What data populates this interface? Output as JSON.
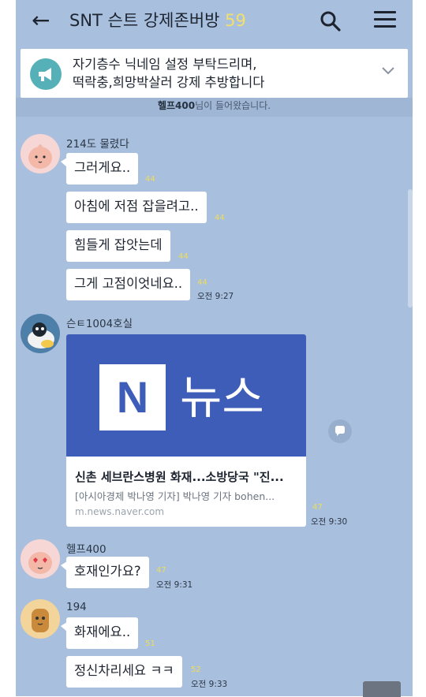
{
  "header": {
    "back": "←",
    "title": "SNT 슨트 강제존버방",
    "member_count": "59"
  },
  "notice": {
    "line1": "자기층수 닉네임 설정 부탁드리며,",
    "line2": "떡락충,희망박살러 강제 추방합니다"
  },
  "system_message": {
    "name": "헬프400",
    "suffix": "님이 들어왔습니다."
  },
  "messages": [
    {
      "sender": "214도 물렸다",
      "bubbles": [
        {
          "text": "그러게요..",
          "unread": "44"
        },
        {
          "text": "아침에 저점 잡을려고..",
          "unread": "44"
        },
        {
          "text": "힘들게 잡앗는데",
          "unread": "44"
        },
        {
          "text": "그게 고점이엇네요..",
          "unread": "44"
        }
      ],
      "time": "오전 9:27"
    },
    {
      "sender": "슨ㅌ1004호실",
      "link": {
        "thumb_letter": "N",
        "thumb_word": "뉴스",
        "title": "신촌 세브란스병원 화재...소방당국 \"진...",
        "desc": "[아시아경제 박나영 기자] 박나영 기자 bohen...",
        "url": "m.news.naver.com"
      },
      "unread": "47",
      "time": "오전 9:30"
    },
    {
      "sender": "헬프400",
      "bubbles": [
        {
          "text": "호재인가요?",
          "unread": "47"
        }
      ],
      "time": "오전 9:31"
    },
    {
      "sender": "194",
      "bubbles": [
        {
          "text": "화재에요..",
          "unread": "51"
        },
        {
          "text": "정신차리세요 ㅋㅋ",
          "unread": "52"
        }
      ],
      "time": "오전 9:33"
    }
  ],
  "colors": {
    "background": "#a8c0de",
    "unread": "#eedd55",
    "link_thumb": "#3d5db8"
  }
}
